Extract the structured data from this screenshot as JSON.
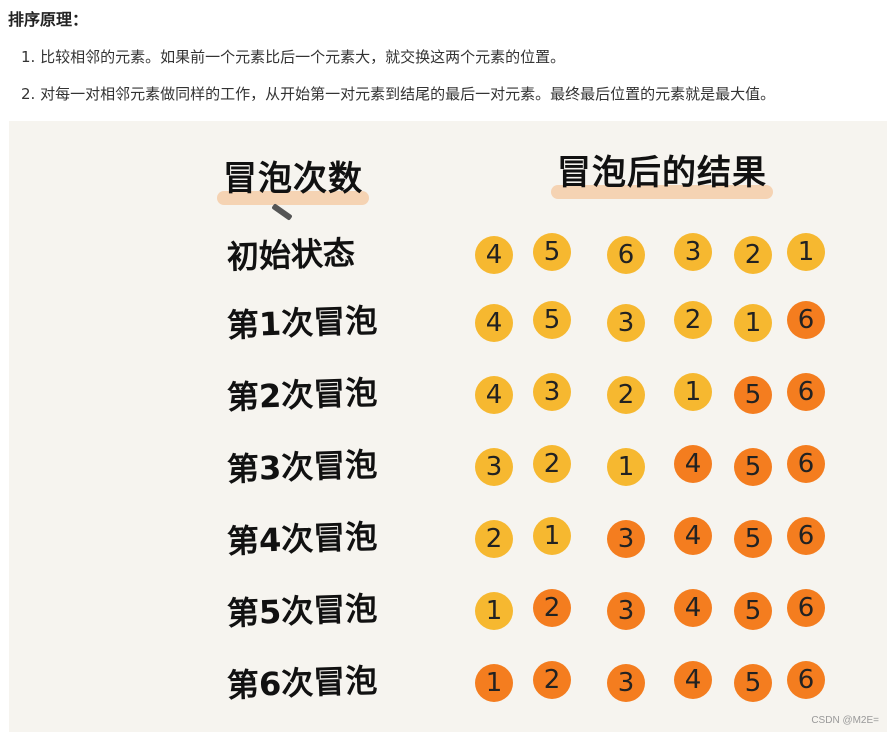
{
  "heading": "排序原理：",
  "steps": [
    "1. 比较相邻的元素。如果前一个元素比后一个元素大，就交换这两个元素的位置。",
    "2. 对每一对相邻元素做同样的工作，从开始第一对元素到结尾的最后一对元素。最终最后位置的元素就是最大值。"
  ],
  "figure": {
    "col_left": "冒泡次数",
    "col_right": "冒泡后的结果",
    "rows": [
      {
        "label": "初始状态",
        "values": [
          "4",
          "5",
          "6",
          "3",
          "2",
          "1"
        ],
        "sorted_count": 0
      },
      {
        "label": "第1次冒泡",
        "values": [
          "4",
          "5",
          "3",
          "2",
          "1",
          "6"
        ],
        "sorted_count": 1
      },
      {
        "label": "第2次冒泡",
        "values": [
          "4",
          "3",
          "2",
          "1",
          "5",
          "6"
        ],
        "sorted_count": 2
      },
      {
        "label": "第3次冒泡",
        "values": [
          "3",
          "2",
          "1",
          "4",
          "5",
          "6"
        ],
        "sorted_count": 3
      },
      {
        "label": "第4次冒泡",
        "values": [
          "2",
          "1",
          "3",
          "4",
          "5",
          "6"
        ],
        "sorted_count": 4
      },
      {
        "label": "第5次冒泡",
        "values": [
          "1",
          "2",
          "3",
          "4",
          "5",
          "6"
        ],
        "sorted_count": 5
      },
      {
        "label": "第6次冒泡",
        "values": [
          "1",
          "2",
          "3",
          "4",
          "5",
          "6"
        ],
        "sorted_count": 6
      }
    ],
    "colors": {
      "unsorted": "#f6b830",
      "sorted": "#f47d1f",
      "background": "#f6f4ef",
      "highlight": "#f5c49a"
    }
  },
  "watermark": "CSDN @M2E="
}
